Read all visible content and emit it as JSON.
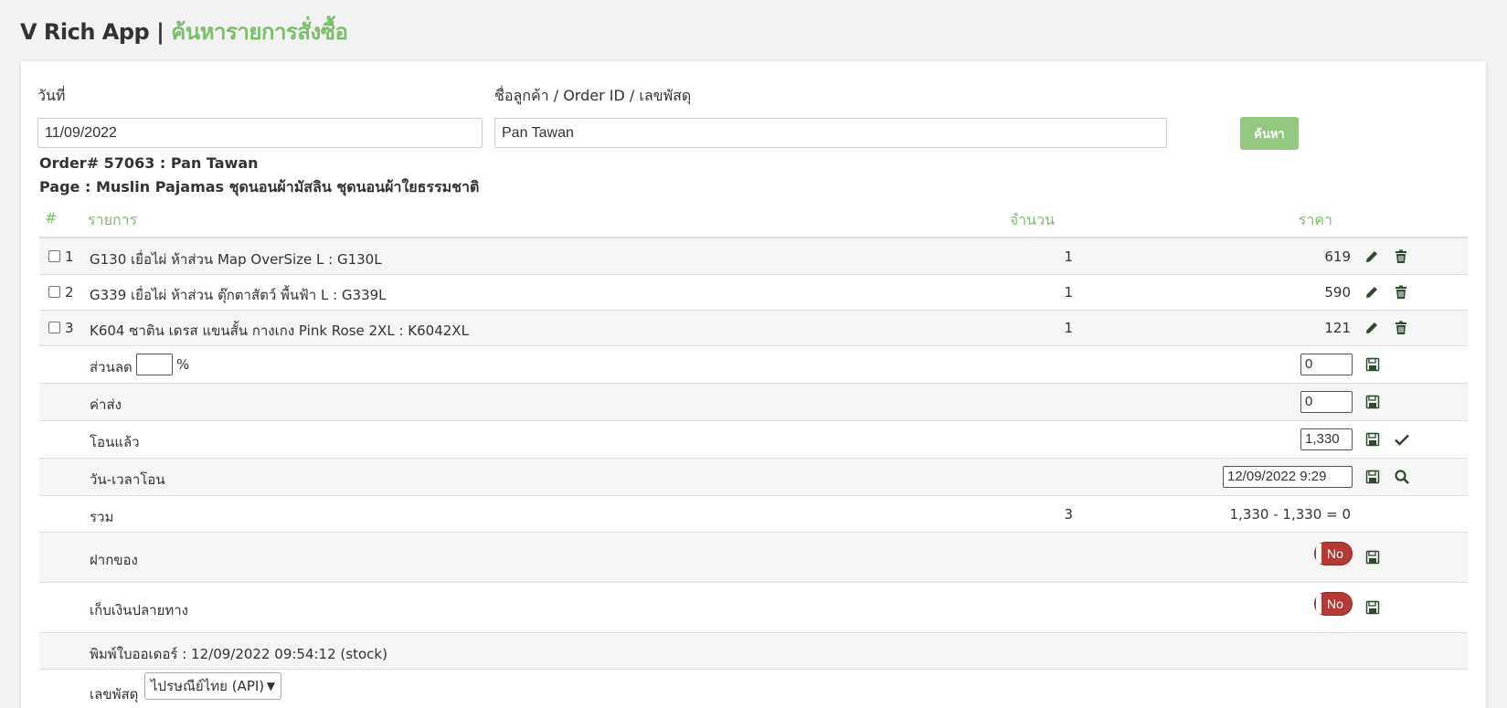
{
  "header": {
    "brand": "V Rich App",
    "separator": "|",
    "page_title": "ค้นหารายการสั่งซื้อ"
  },
  "search": {
    "date_label": "วันที่",
    "date_value": "11/09/2022",
    "query_label": "ชื่อลูกค้า / Order ID / เลขพัสดุ",
    "query_value": "Pan Tawan",
    "button_label": "ค้นหา"
  },
  "order": {
    "title": "Order# 57063 : Pan Tawan",
    "page": "Page : Muslin Pajamas ชุดนอนผ้ามัสลิน ชุดนอนผ้าใยธรรมชาติ"
  },
  "table": {
    "headers": {
      "index": "#",
      "item": "รายการ",
      "qty": "จำนวน",
      "price": "ราคา"
    },
    "items": [
      {
        "no": "1",
        "name": "G130 เยื่อไผ่ ห้าส่วน Map OverSize L : G130L",
        "qty": "1",
        "price": "619"
      },
      {
        "no": "2",
        "name": "G339 เยื่อไผ่ ห้าส่วน ตุ๊กตาสัตว์ พื้นฟ้า L : G339L",
        "qty": "1",
        "price": "590"
      },
      {
        "no": "3",
        "name": "K604 ซาติน เดรส แขนสั้น กางเกง Pink Rose 2XL : K6042XL",
        "qty": "1",
        "price": "121"
      }
    ]
  },
  "discount": {
    "label": "ส่วนลด",
    "percent_value": "",
    "percent_sign": "%",
    "amount": "0"
  },
  "shipping": {
    "label": "ค่าส่ง",
    "amount": "0"
  },
  "paid": {
    "label": "โอนแล้ว",
    "amount": "1,330"
  },
  "transfer_time": {
    "label": "วัน-เวลาโอน",
    "value": "12/09/2022 9:29"
  },
  "total": {
    "label": "รวม",
    "qty": "3",
    "summary": "1,330 - 1,330 = 0"
  },
  "deposit": {
    "label": "ฝากของ",
    "toggle": "No"
  },
  "cod": {
    "label": "เก็บเงินปลายทาง",
    "toggle": "No"
  },
  "print_info": {
    "text": "พิมพ์ใบออเดอร์ : 12/09/2022 09:54:12 (stock)"
  },
  "tracking": {
    "label": "เลขพัสดุ",
    "carrier": "ไปรษณีย์ไทย (API)"
  },
  "colors": {
    "accent": "#7cbf6a",
    "button": "#92c77f",
    "toggle_off": "#b53a35",
    "icon": "#2f4a2f"
  }
}
